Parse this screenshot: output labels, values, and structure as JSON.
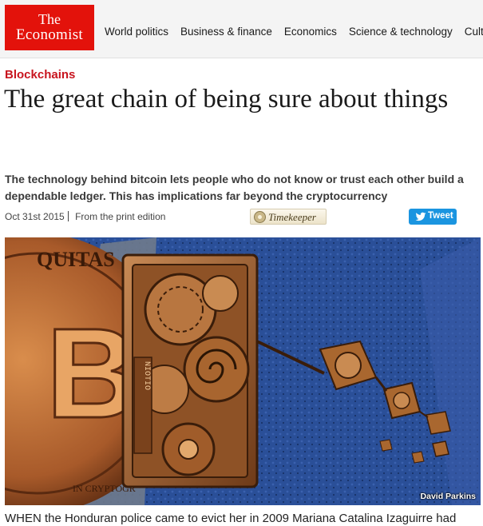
{
  "header": {
    "logo_line1": "The",
    "logo_line2": "Economist",
    "nav": [
      {
        "label": "World politics"
      },
      {
        "label": "Business & finance"
      },
      {
        "label": "Economics"
      },
      {
        "label": "Science & technology"
      },
      {
        "label": "Culture"
      }
    ]
  },
  "article": {
    "section": "Blockchains",
    "headline": "The great chain of being sure about things",
    "rubric": "The technology behind bitcoin lets people who do not know or trust each other build a dependable ledger. This has implications far beyond the cryptocurrency",
    "date": "Oct 31st 2015",
    "edition_link": "From the print edition",
    "timekeeper_label": "Timekeeper",
    "tweet_label": "Tweet",
    "illustration": {
      "credit": "David Parkins",
      "coin_text_top": "QUITAS",
      "coin_text_bottom": "IN CRYPTOGR",
      "gear_text": "NIOTIO"
    },
    "body_first_line": "WHEN the Honduran police came to evict her in 2009 Mariana Catalina Izaguirre had"
  },
  "colors": {
    "brand_red": "#e3120b",
    "section_red": "#c8141e",
    "tweet_blue": "#1b95e0"
  }
}
